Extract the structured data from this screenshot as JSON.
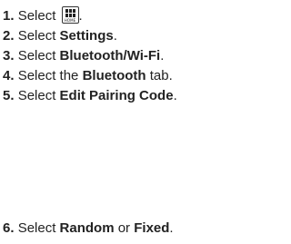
{
  "heading_fragment": "",
  "steps": [
    {
      "num": "1.",
      "pre": "Select ",
      "bold": "",
      "post": ".",
      "icon": "home-grid-icon",
      "icon_label": "HOME"
    },
    {
      "num": "2.",
      "pre": "Select ",
      "bold": "Settings",
      "post": "."
    },
    {
      "num": "3.",
      "pre": "Select ",
      "bold": "Bluetooth/Wi-Fi",
      "post": "."
    },
    {
      "num": "4.",
      "pre": "Select the ",
      "bold": "Bluetooth",
      "post": " tab."
    },
    {
      "num": "5.",
      "pre": "Select ",
      "bold": "Edit Pairing Code",
      "post": "."
    },
    {
      "num": "6.",
      "pre": "Select ",
      "bold": "Random",
      "mid": " or ",
      "bold2": "Fixed",
      "post": "."
    }
  ]
}
